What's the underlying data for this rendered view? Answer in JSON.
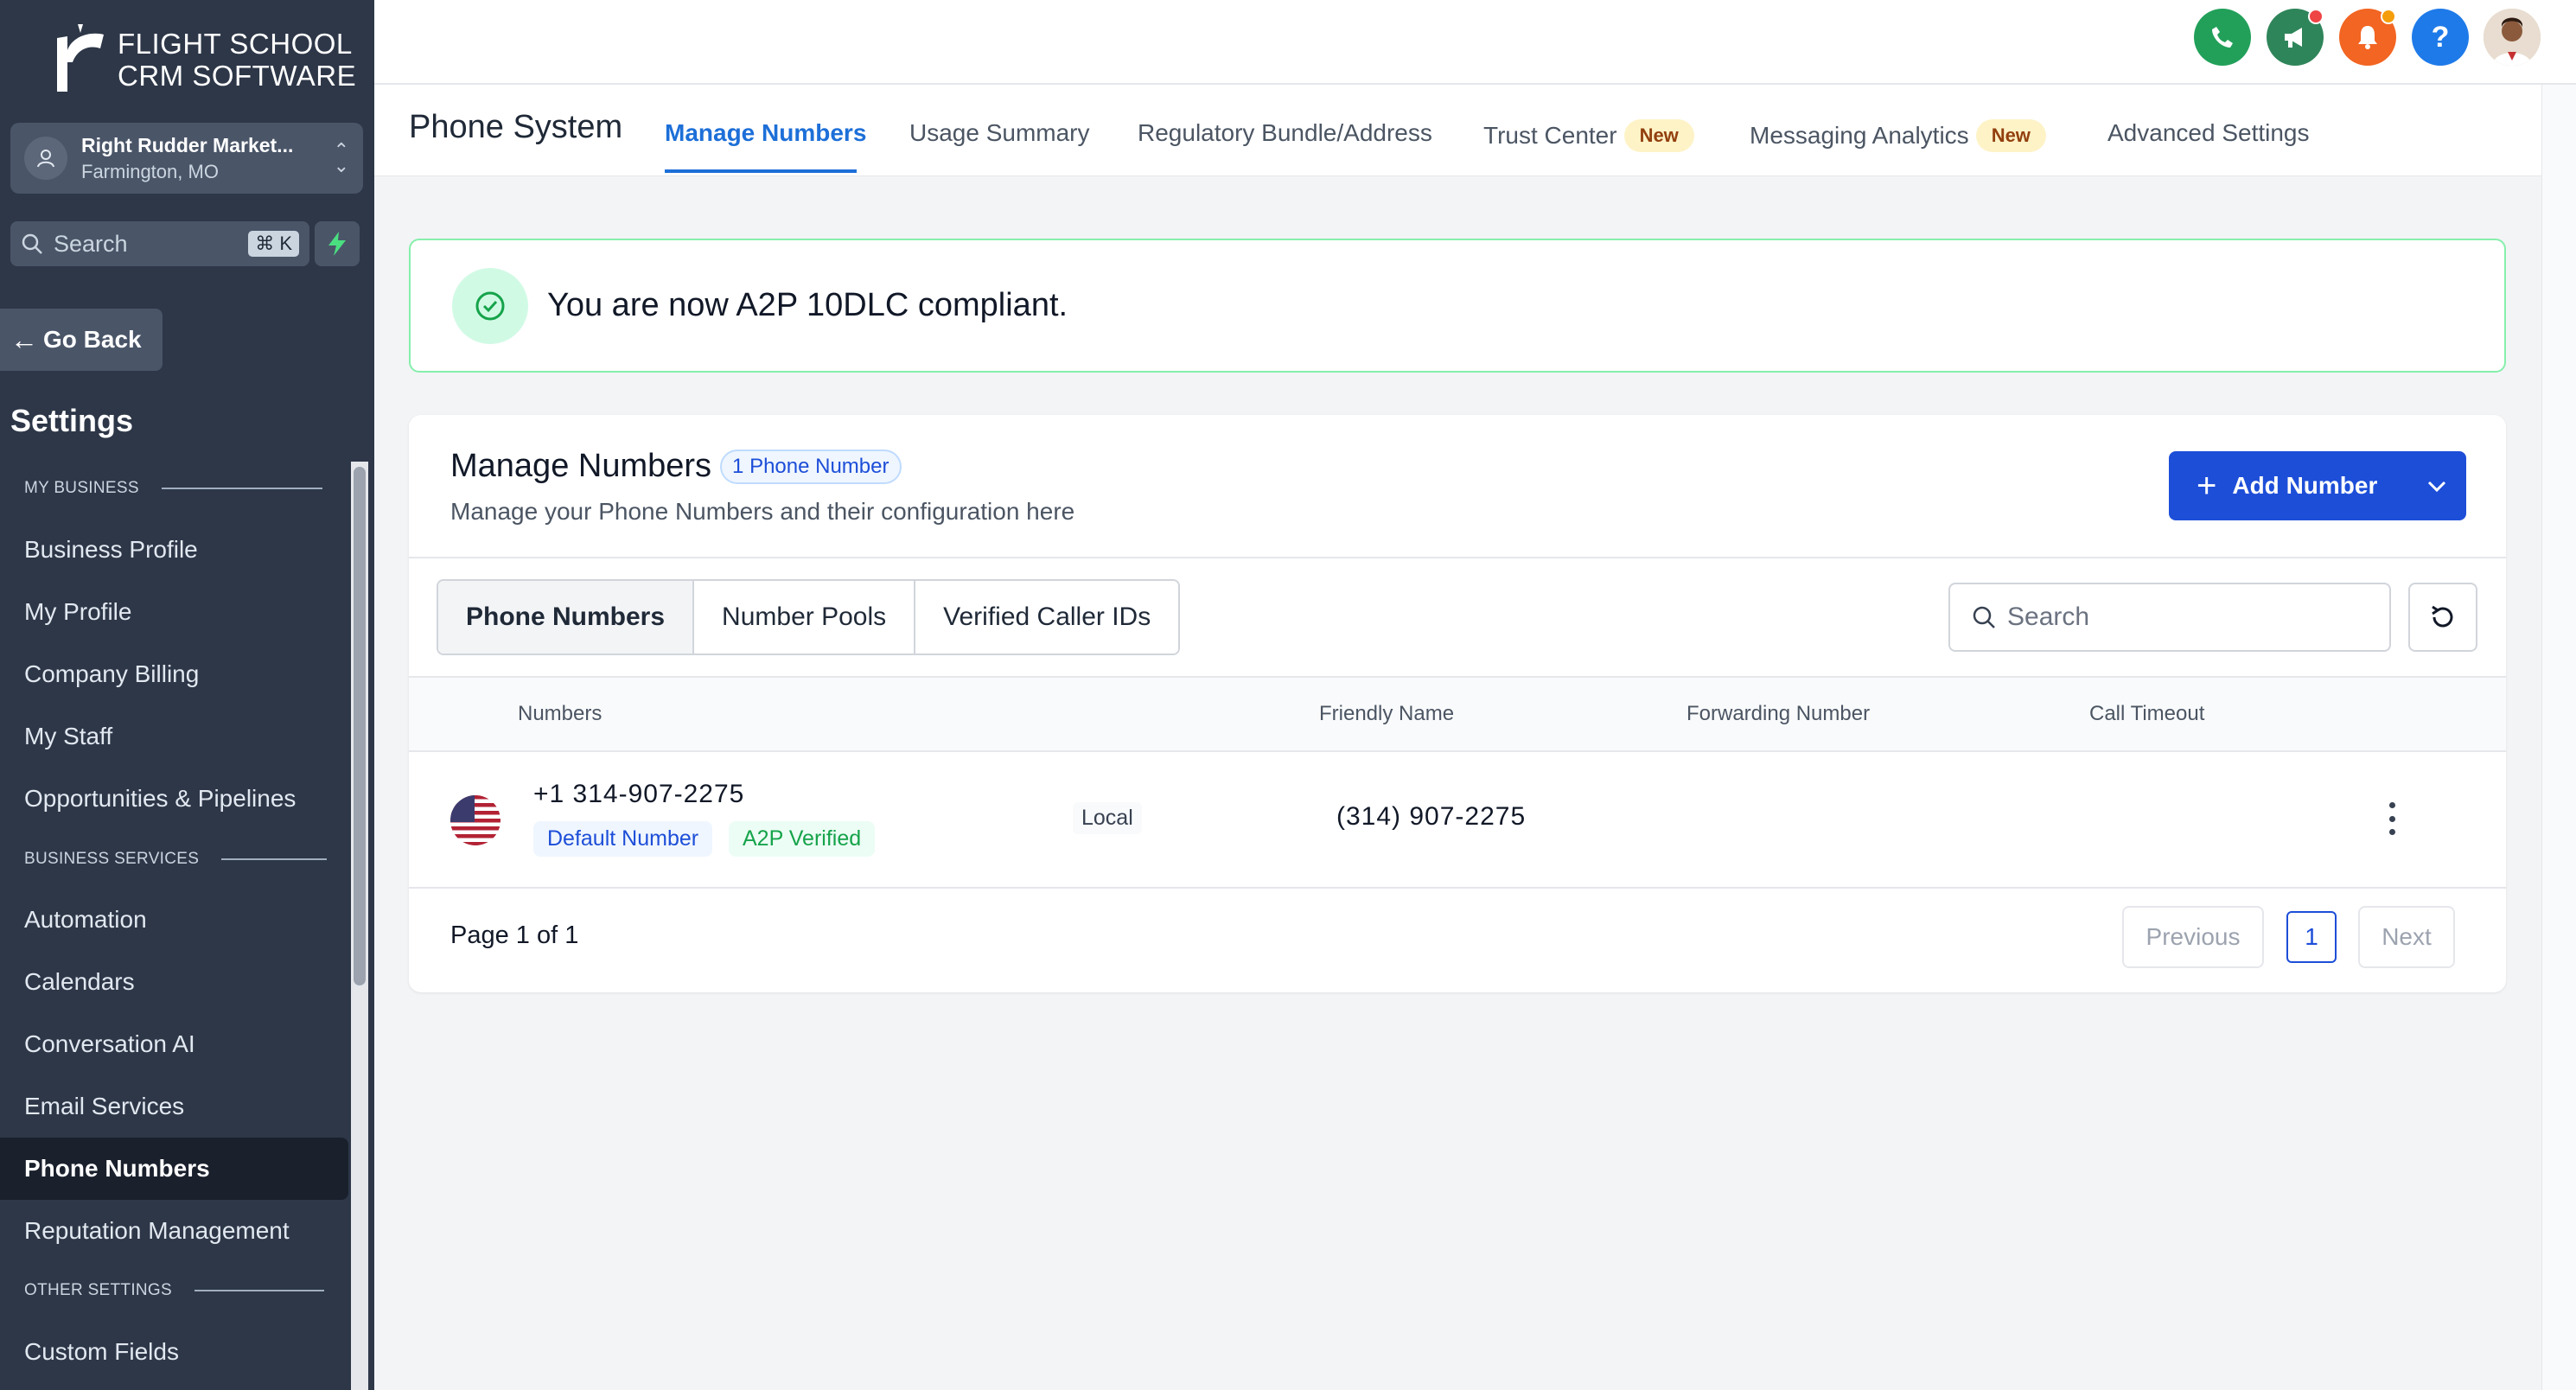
{
  "brand": {
    "line1": "FLIGHT SCHOOL",
    "line2": "CRM SOFTWARE"
  },
  "account": {
    "name": "Right Rudder Market...",
    "location": "Farmington, MO"
  },
  "sidebar": {
    "search_placeholder": "Search",
    "search_shortcut": "⌘ K",
    "go_back": "Go Back",
    "settings_title": "Settings",
    "sections": [
      "MY BUSINESS",
      "BUSINESS SERVICES",
      "OTHER SETTINGS"
    ],
    "items": [
      "Business Profile",
      "My Profile",
      "Company Billing",
      "My Staff",
      "Opportunities & Pipelines",
      "Automation",
      "Calendars",
      "Conversation AI",
      "Email Services",
      "Phone Numbers",
      "Reputation Management",
      "Custom Fields"
    ],
    "active_item": "Phone Numbers"
  },
  "topbar": {
    "icons": [
      "phone-icon",
      "megaphone-icon",
      "bell-icon",
      "help-icon",
      "user-avatar"
    ],
    "colors": {
      "phone": "#22a05a",
      "megaphone": "#2f855a",
      "bell": "#f26522",
      "help": "#1e7ae8",
      "dot": "#ef4444"
    },
    "help_glyph": "?"
  },
  "subnav": {
    "title": "Phone System",
    "tabs": [
      {
        "label": "Manage Numbers",
        "active": true
      },
      {
        "label": "Usage Summary"
      },
      {
        "label": "Regulatory Bundle/Address"
      },
      {
        "label": "Trust Center",
        "badge": "New"
      },
      {
        "label": "Messaging Analytics",
        "badge": "New"
      },
      {
        "label": "Advanced Settings"
      }
    ]
  },
  "alert": {
    "text": "You are now A2P 10DLC compliant.",
    "color": "#22c55e"
  },
  "manage": {
    "title": "Manage Numbers",
    "count_badge": "1 Phone Number",
    "subtitle": "Manage your Phone Numbers and their configuration here",
    "add_button": "Add Number",
    "segments": [
      {
        "label": "Phone Numbers",
        "active": true
      },
      {
        "label": "Number Pools"
      },
      {
        "label": "Verified Caller IDs"
      }
    ],
    "search_placeholder": "Search",
    "columns": [
      "Numbers",
      "Friendly Name",
      "Forwarding Number",
      "Call Timeout"
    ],
    "rows": [
      {
        "country_flag": "us-flag-icon",
        "number": "+1 314-907-2275",
        "tags": [
          "Default Number",
          "A2P Verified"
        ],
        "type": "Local",
        "friendly_name": "(314) 907-2275",
        "forwarding_number": "",
        "call_timeout": ""
      }
    ],
    "pagination": {
      "info": "Page 1 of 1",
      "previous": "Previous",
      "current": "1",
      "next": "Next"
    }
  },
  "accent_color": "#1d4ed8"
}
